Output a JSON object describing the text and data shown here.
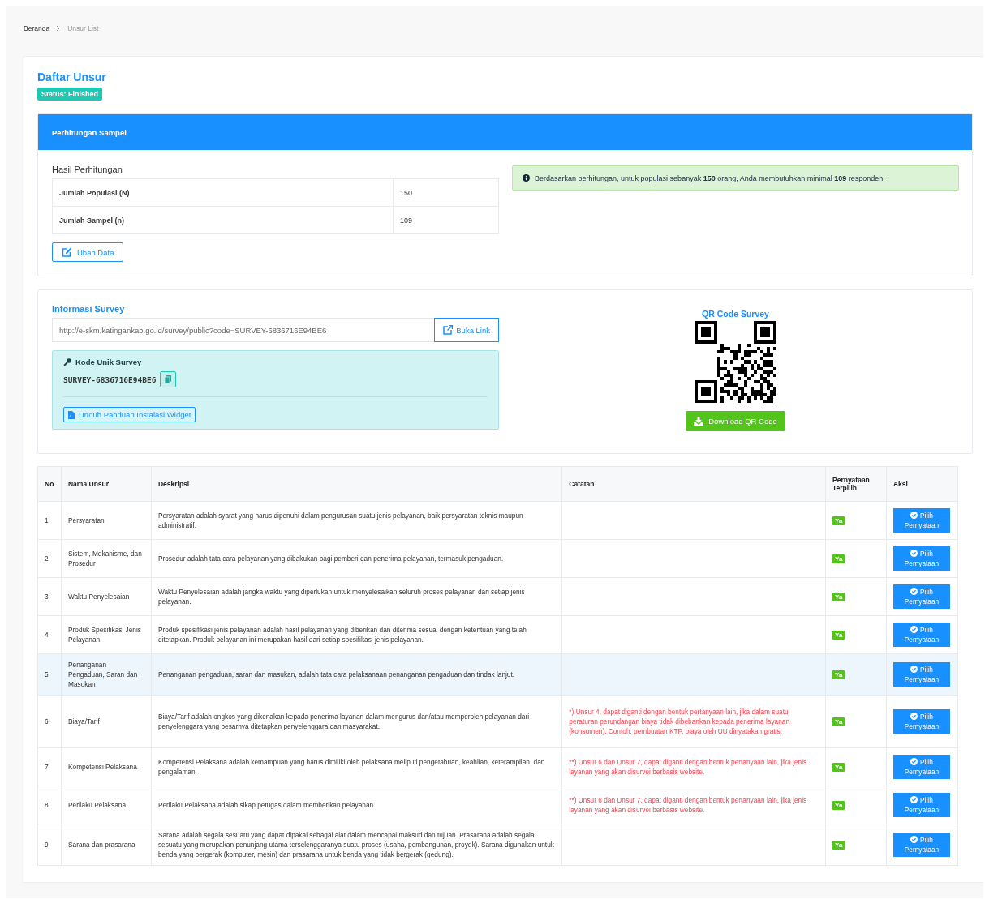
{
  "breadcrumb": [
    {
      "label": "Beranda",
      "current": false
    },
    {
      "label": "Unsur List",
      "current": true
    }
  ],
  "page_title": "Daftar Unsur",
  "status_badge": "Status: Finished",
  "sample_panel": {
    "header": "Perhitungan Sampel",
    "subtitle": "Hasil Perhitungan",
    "rows": [
      {
        "label": "Jumlah Populasi (N)",
        "value": "150"
      },
      {
        "label": "Jumlah Sampel (n)",
        "value": "109"
      }
    ],
    "edit_button": "Ubah Data",
    "alert": "Berdasarkan perhitungan, untuk populasi sebanyak **150** orang, Anda membutuhkan minimal **109** responden."
  },
  "survey_info": {
    "title": "Informasi Survey",
    "link_field": {
      "value": "http://e-skm.katingankab.go.id/survey/public?code=SURVEY-6836716E94BE6"
    },
    "open_link_button": "Buka Link",
    "code_box": {
      "title": "Kode Unik Survey",
      "code": "SURVEY-6836716E94BE6",
      "download_guide_button": "Unduh Panduan Instalasi Widget"
    },
    "qr_title": "QR Code Survey",
    "qr_download_button": "Download QR Code"
  },
  "table": {
    "columns": [
      "No",
      "Nama Unsur",
      "Deskripsi",
      "Catatan",
      "Pernyataan Terpilih",
      "Aksi"
    ],
    "rows": [
      {
        "no": "1",
        "name": "Persyaratan",
        "description": "Persyaratan adalah syarat yang harus dipenuhi dalam pengurusan suatu jenis pelayanan, baik persyaratan teknis maupun administratif.",
        "note": "",
        "selected_badge": "Ya",
        "action": "Pilih Pernyataan",
        "selected": false
      },
      {
        "no": "2",
        "name": "Sistem, Mekanisme, dan Prosedur",
        "description": "Prosedur adalah tata cara pelayanan yang dibakukan bagi pemberi dan penerima pelayanan, termasuk pengaduan.",
        "note": "",
        "selected_badge": "Ya",
        "action": "Pilih Pernyataan",
        "selected": false
      },
      {
        "no": "3",
        "name": "Waktu Penyelesaian",
        "description": "Waktu Penyelesaian adalah jangka waktu yang diperlukan untuk menyelesaikan seluruh proses pelayanan dari setiap jenis pelayanan.",
        "note": "",
        "selected_badge": "Ya",
        "action": "Pilih Pernyataan",
        "selected": false
      },
      {
        "no": "4",
        "name": "Produk Spesifikasi Jenis Pelayanan",
        "description": "Produk spesifikasi jenis pelayanan adalah hasil pelayanan yang diberikan dan diterima sesuai dengan ketentuan yang telah ditetapkan. Produk pelayanan ini merupakan hasil dari setiap spesifikasi jenis pelayanan.",
        "note": "",
        "selected_badge": "Ya",
        "action": "Pilih Pernyataan",
        "selected": false
      },
      {
        "no": "5",
        "name": "Penanganan Pengaduan, Saran dan Masukan",
        "description": "Penanganan pengaduan, saran dan masukan, adalah tata cara pelaksanaan penanganan pengaduan dan tindak lanjut.",
        "note": "",
        "selected_badge": "Ya",
        "action": "Pilih Pernyataan",
        "selected": true
      },
      {
        "no": "6",
        "name": "Biaya/Tarif",
        "description": "Biaya/Tarif adalah ongkos yang dikenakan kepada penerima layanan dalam mengurus dan/atau memperoleh pelayanan dari penyelenggara yang besarnya ditetapkan penyelenggara dan masyarakat.",
        "note": "*) Unsur 4, dapat diganti dengan bentuk pertanyaan lain, jika dalam suatu peraturan perundangan biaya tidak dibebankan kepada penerima layanan (konsumen). Contoh: pembuatan KTP, biaya oleh UU dinyatakan gratis.",
        "selected_badge": "Ya",
        "action": "Pilih Pernyataan",
        "selected": false
      },
      {
        "no": "7",
        "name": "Kompetensi Pelaksana",
        "description": "Kompetensi Pelaksana adalah kemampuan yang harus dimiliki oleh pelaksana meliputi pengetahuan, keahlian, keterampilan, dan pengalaman.",
        "note": "**) Unsur 6 dan Unsur 7, dapat diganti dengan bentuk pertanyaan lain, jika jenis layanan yang akan disurvei berbasis website.",
        "selected_badge": "Ya",
        "action": "Pilih Pernyataan",
        "selected": false
      },
      {
        "no": "8",
        "name": "Perilaku Pelaksana",
        "description": "Perilaku Pelaksana adalah sikap petugas dalam memberikan pelayanan.",
        "note": "**) Unsur 6 dan Unsur 7, dapat diganti dengan bentuk pertanyaan lain, jika jenis layanan yang akan disurvei berbasis website.",
        "selected_badge": "Ya",
        "action": "Pilih Pernyataan",
        "selected": false
      },
      {
        "no": "9",
        "name": "Sarana dan prasarana",
        "description": "Sarana adalah segala sesuatu yang dapat dipakai sebagai alat dalam mencapai maksud dan tujuan. Prasarana adalah segala sesuatu yang merupakan penunjang utama terselenggaranya suatu proses (usaha, pembangunan, proyek). Sarana digunakan untuk benda yang bergerak (komputer, mesin) dan prasarana untuk benda yang tidak bergerak (gedung).",
        "note": "",
        "selected_badge": "Ya",
        "action": "Pilih Pernyataan",
        "selected": false
      }
    ]
  }
}
